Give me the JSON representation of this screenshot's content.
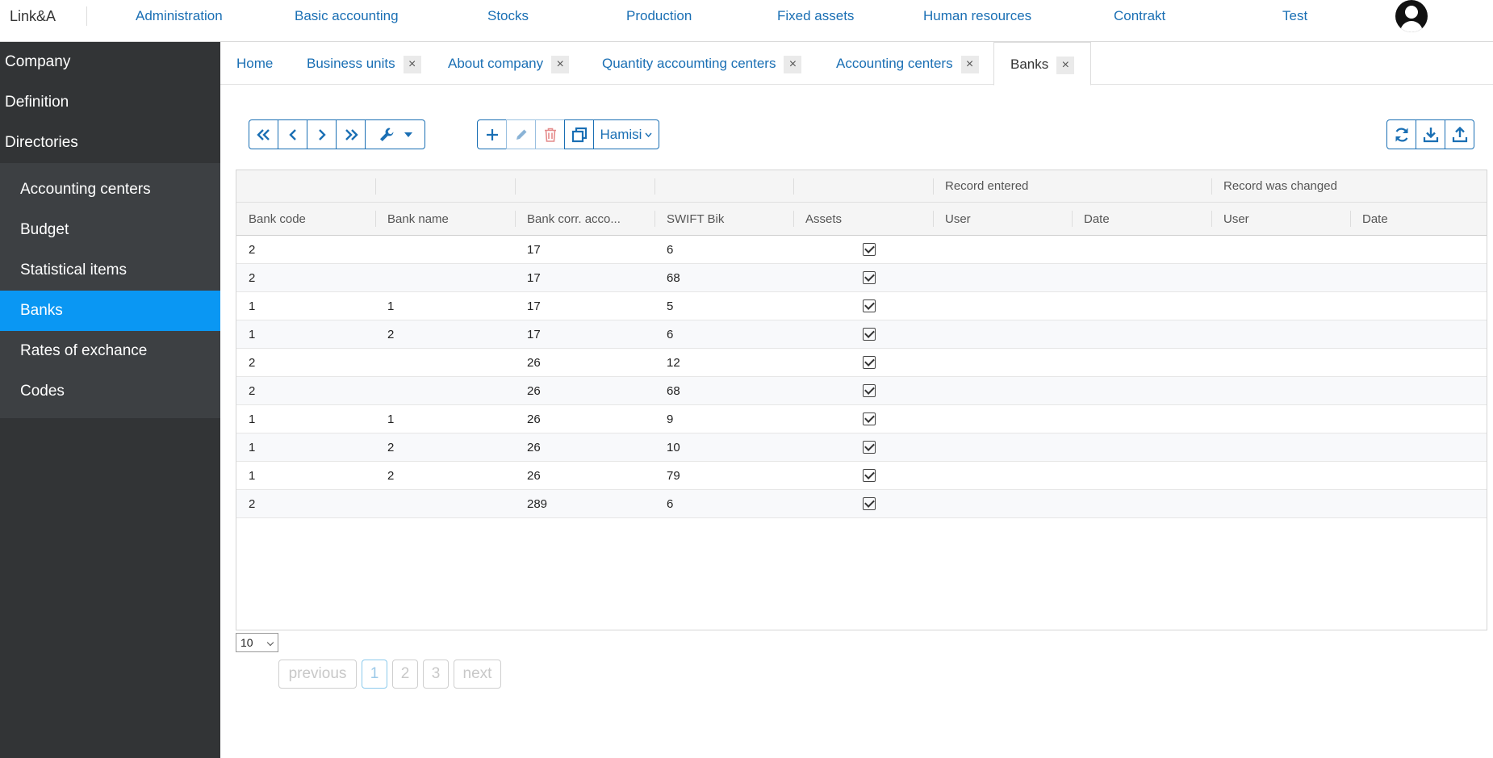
{
  "app": {
    "brand": "Link&A"
  },
  "topnav": [
    {
      "label": "Administration"
    },
    {
      "label": "Basic accounting"
    },
    {
      "label": "Stocks"
    },
    {
      "label": "Production"
    },
    {
      "label": "Fixed assets"
    },
    {
      "label": "Human resources"
    },
    {
      "label": "Contrakt"
    },
    {
      "label": "Test"
    }
  ],
  "sidebar": {
    "sections": [
      {
        "label": "Company"
      },
      {
        "label": "Definition"
      },
      {
        "label": "Directories"
      }
    ],
    "items": [
      {
        "label": "Accounting centers"
      },
      {
        "label": "Budget"
      },
      {
        "label": "Statistical items"
      },
      {
        "label": "Banks"
      },
      {
        "label": "Rates of exchance"
      },
      {
        "label": "Codes"
      }
    ]
  },
  "tabs": [
    {
      "label": "Home"
    },
    {
      "label": "Business units"
    },
    {
      "label": "About company"
    },
    {
      "label": "Quantity accoumting centers"
    },
    {
      "label": "Accounting centers"
    },
    {
      "label": "Banks"
    }
  ],
  "tab_close_glyph": "×",
  "toolbar": {
    "layout_label": "Hamisi",
    "icons": [
      "double-chevron-left-icon",
      "chevron-left-icon",
      "chevron-right-icon",
      "double-chevron-right-icon",
      "wrench-icon",
      "plus-icon",
      "pencil-icon",
      "trash-icon",
      "copy-icon",
      "refresh-icon",
      "download-icon",
      "upload-icon"
    ]
  },
  "grid": {
    "group_headers": {
      "entered": "Record entered",
      "changed": "Record was changed"
    },
    "columns": [
      "Bank code",
      "Bank name",
      "Bank corr. acco...",
      "SWIFT Bik",
      "Assets",
      "User",
      "Date",
      "User",
      "Date"
    ],
    "rows": [
      {
        "code": "2",
        "name": "",
        "corr": "17",
        "swift": "6"
      },
      {
        "code": "2",
        "name": "",
        "corr": "17",
        "swift": "68"
      },
      {
        "code": "1",
        "name": "1",
        "corr": "17",
        "swift": "5"
      },
      {
        "code": "1",
        "name": "2",
        "corr": "17",
        "swift": "6"
      },
      {
        "code": "2",
        "name": "",
        "corr": "26",
        "swift": "12"
      },
      {
        "code": "2",
        "name": "",
        "corr": "26",
        "swift": "68"
      },
      {
        "code": "1",
        "name": "1",
        "corr": "26",
        "swift": "9"
      },
      {
        "code": "1",
        "name": "2",
        "corr": "26",
        "swift": "10"
      },
      {
        "code": "1",
        "name": "2",
        "corr": "26",
        "swift": "79"
      },
      {
        "code": "2",
        "name": "",
        "corr": "289",
        "swift": "6"
      }
    ]
  },
  "pager": {
    "page_size": "10",
    "previous": "previous",
    "next": "next",
    "pages": [
      "1",
      "2",
      "3"
    ]
  }
}
